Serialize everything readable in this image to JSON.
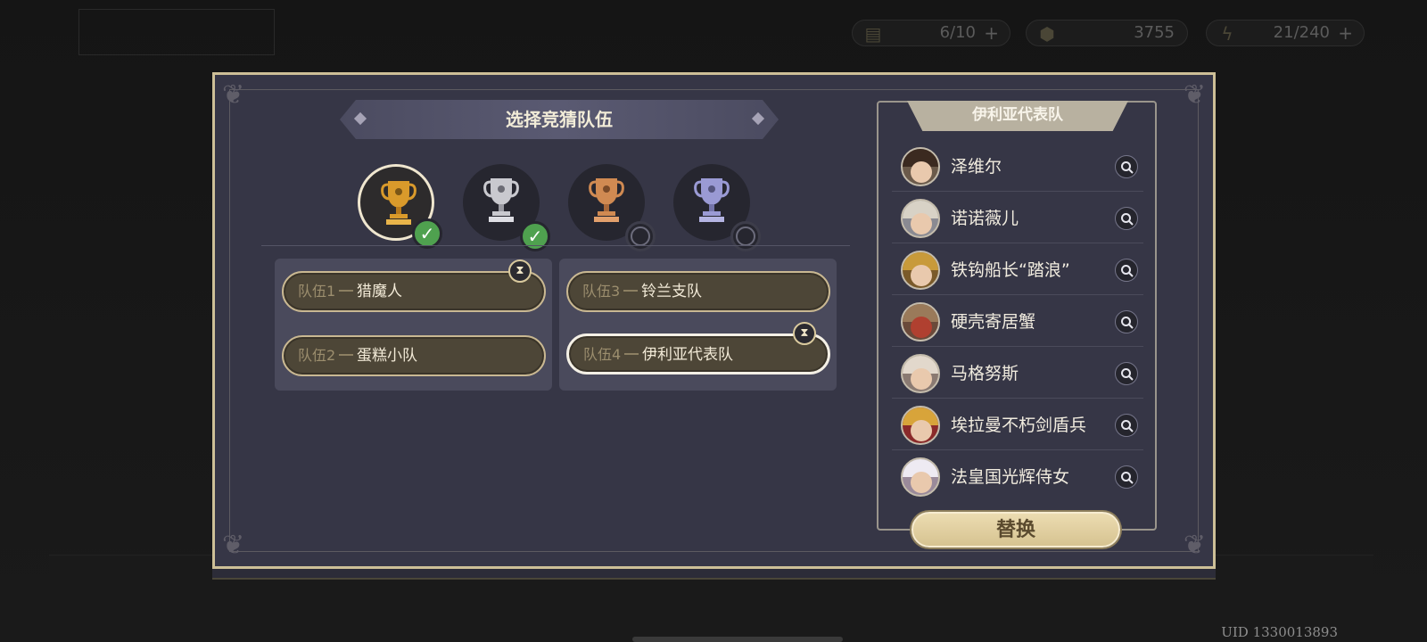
{
  "background": {
    "title": "",
    "resources": [
      {
        "icon": "ticket-icon",
        "value": "6/10",
        "plus": "+"
      },
      {
        "icon": "coin-icon",
        "value": "3755"
      },
      {
        "icon": "energy-icon",
        "value": "21/240",
        "plus": "+"
      }
    ],
    "uid": "UID 1330013893"
  },
  "modal": {
    "title": "选择竞猜队伍",
    "trophies": [
      {
        "name": "gold-trophy-icon",
        "color": "#d99a2b",
        "selected": true,
        "checked": true
      },
      {
        "name": "silver-trophy-icon",
        "color": "#c9c9cf",
        "selected": false,
        "checked": true
      },
      {
        "name": "bronze-trophy-icon",
        "color": "#d08a52",
        "selected": false,
        "checked": false
      },
      {
        "name": "lavender-trophy-icon",
        "color": "#9a9ad4",
        "selected": false,
        "checked": false
      }
    ],
    "teams": [
      {
        "number": "队伍1",
        "name": "猎魔人"
      },
      {
        "number": "队伍2",
        "name": "蛋糕小队"
      },
      {
        "number": "队伍3",
        "name": "铃兰支队"
      },
      {
        "number": "队伍4",
        "name": "伊利亚代表队"
      }
    ],
    "roster": {
      "title": "伊利亚代表队",
      "members": [
        "泽维尔",
        "诺诺薇儿",
        "铁钩船长“踏浪”",
        "硬壳寄居蟹",
        "马格努斯",
        "埃拉曼不朽剑盾兵",
        "法皇国光辉侍女"
      ]
    },
    "replace_label": "替换",
    "colors": {
      "accent": "#cdbf97",
      "panel": "#363646",
      "check": "#4fa14f"
    }
  }
}
